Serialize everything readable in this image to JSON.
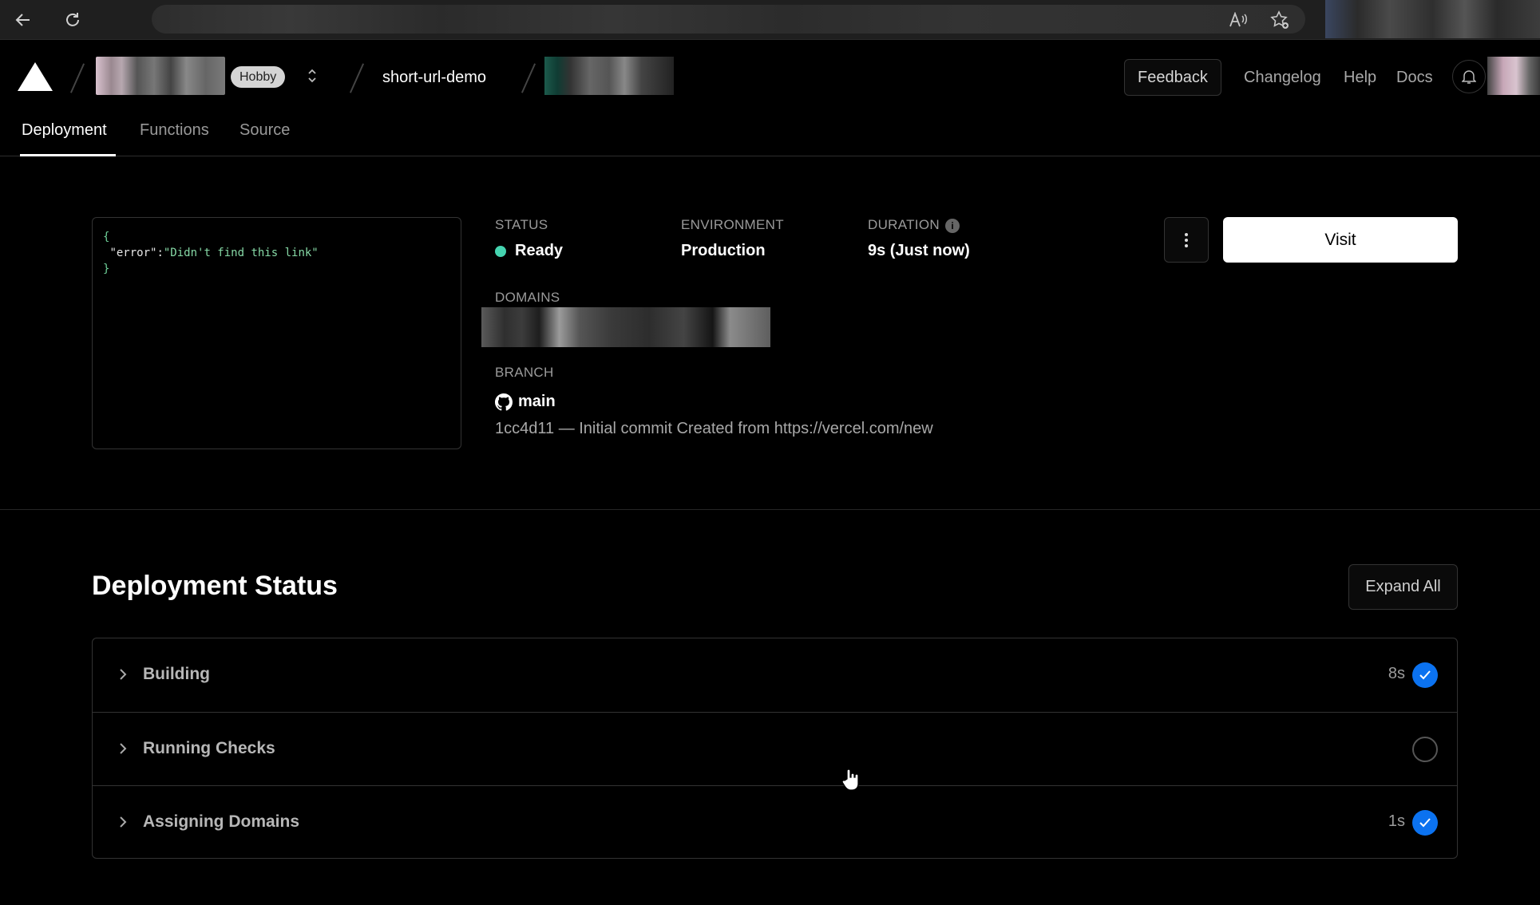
{
  "topbar": {
    "plan_badge": "Hobby",
    "project_name": "short-url-demo",
    "feedback_label": "Feedback",
    "links": [
      "Changelog",
      "Help",
      "Docs"
    ]
  },
  "tabs": [
    {
      "label": "Deployment",
      "active": true
    },
    {
      "label": "Functions",
      "active": false
    },
    {
      "label": "Source",
      "active": false
    }
  ],
  "preview": {
    "line1": "{",
    "key": "\"error\":",
    "value": "\"Didn't find this link\"",
    "line3": "}"
  },
  "overview": {
    "status_label": "STATUS",
    "status_value": "Ready",
    "status_color": "#45d4b0",
    "environment_label": "ENVIRONMENT",
    "environment_value": "Production",
    "duration_label": "DURATION",
    "duration_value": "9s (Just now)",
    "domains_label": "DOMAINS",
    "branch_label": "BRANCH",
    "branch_value": "main",
    "commit": "1cc4d11 — Initial commit Created from https://vercel.com/new",
    "visit_label": "Visit"
  },
  "deployment_status": {
    "title": "Deployment Status",
    "expand_label": "Expand All",
    "steps": [
      {
        "label": "Building",
        "time": "8s",
        "state": "done"
      },
      {
        "label": "Running Checks",
        "time": "",
        "state": "pending"
      },
      {
        "label": "Assigning Domains",
        "time": "1s",
        "state": "done"
      }
    ],
    "done_color": "#0b72f0"
  }
}
